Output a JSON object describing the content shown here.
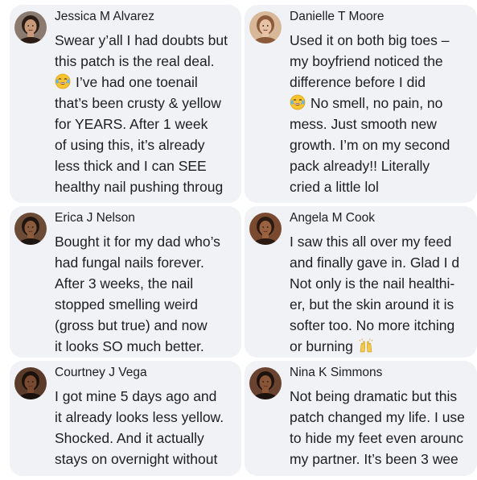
{
  "comments": [
    {
      "author": "Jessica M Alvarez",
      "lines": [
        "Swear y’all I had doubts but",
        "this patch is the real deal.",
        "I’ve had one toenail",
        "that’s been crusty & yellow",
        "for YEARS. After 1 week",
        "of using this, it’s already",
        "less thick and I can SEE",
        "healthy nail pushing throug"
      ],
      "emoji": "😂",
      "emoji_line": 2,
      "avatar_colors": {
        "skin": "#c99a7a",
        "hair": "#2b1d16",
        "bg": "#8a7a70"
      }
    },
    {
      "author": "Danielle T Moore",
      "lines": [
        "Used it on both big toes –",
        "my boyfriend noticed the",
        "difference before I did",
        "No smell, no pain, no",
        "mess. Just smooth new",
        "growth. I’m on my second",
        "pack already!! Literally",
        "cried a little lol"
      ],
      "emoji": "😂",
      "emoji_line": 3,
      "avatar_colors": {
        "skin": "#e7c2a4",
        "hair": "#8b5a3a",
        "bg": "#d9b89a"
      }
    },
    {
      "author": "Erica J Nelson",
      "lines": [
        "Bought it for my dad who’s",
        "had fungal nails forever.",
        "After 3 weeks, the nail",
        "stopped smelling weird",
        "(gross but true) and now",
        "it looks SO much better."
      ],
      "emoji": "",
      "emoji_line": -1,
      "avatar_colors": {
        "skin": "#8a5a3c",
        "hair": "#1f1510",
        "bg": "#6b4a36"
      }
    },
    {
      "author": "Angela M Cook",
      "lines": [
        "I saw this all over my feed",
        "and finally gave in. Glad I d",
        "Not only is the nail healthi-",
        "er, but the skin around it is",
        "softer too. No more itching",
        "or burning"
      ],
      "emoji": "🙌",
      "emoji_line": 5,
      "avatar_colors": {
        "skin": "#9a6240",
        "hair": "#2a1a12",
        "bg": "#7a4a30"
      }
    },
    {
      "author": "Courtney J Vega",
      "lines": [
        "I got mine 5 days ago and",
        "it already looks less yellow.",
        "Shocked. And it actually",
        "stays on overnight without"
      ],
      "emoji": "",
      "emoji_line": -1,
      "avatar_colors": {
        "skin": "#7a4a30",
        "hair": "#1a110c",
        "bg": "#5a3a28"
      }
    },
    {
      "author": "Nina K Simmons",
      "lines": [
        "Not being dramatic but this",
        "patch changed my life. I use",
        "to hide my feet even arounc",
        "my partner. It’s been 3 wee"
      ],
      "emoji": "",
      "emoji_line": -1,
      "avatar_colors": {
        "skin": "#8a5536",
        "hair": "#1d130e",
        "bg": "#6a4230"
      }
    }
  ],
  "theme": {
    "card_bg": "#f0f2f5",
    "text": "#1c1e21",
    "page_bg": "#ffffff"
  }
}
